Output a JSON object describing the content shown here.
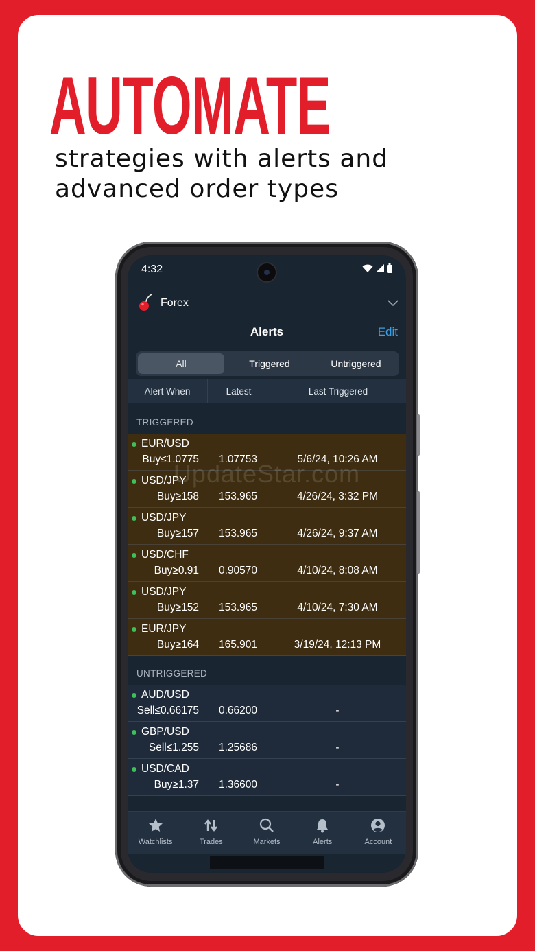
{
  "promo": {
    "headline": "AUTOMATE",
    "subline_1": "strategies with alerts and",
    "subline_2": "advanced order types"
  },
  "colors": {
    "brand_red": "#e31e2b",
    "accent_blue": "#3aa0e8",
    "trigger_row": "#3e2d10",
    "status_green": "#3fbf5a"
  },
  "status_bar": {
    "time": "4:32",
    "icons": [
      "wifi-icon",
      "signal-icon",
      "battery-icon"
    ]
  },
  "account_selector": {
    "label": "Forex",
    "icon": "cherry-icon"
  },
  "header": {
    "title": "Alerts",
    "edit_label": "Edit"
  },
  "segments": [
    {
      "label": "All",
      "selected": true
    },
    {
      "label": "Triggered",
      "selected": false
    },
    {
      "label": "Untriggered",
      "selected": false
    }
  ],
  "columns": [
    "Alert When",
    "Latest",
    "Last Triggered"
  ],
  "watermark": "UpdateStar.com",
  "triggered": {
    "label": "TRIGGERED",
    "rows": [
      {
        "pair": "EUR/USD",
        "condition": "Buy≤1.0775",
        "latest": "1.07753",
        "last_triggered": "5/6/24, 10:26 AM"
      },
      {
        "pair": "USD/JPY",
        "condition": "Buy≥158",
        "latest": "153.965",
        "last_triggered": "4/26/24, 3:32 PM"
      },
      {
        "pair": "USD/JPY",
        "condition": "Buy≥157",
        "latest": "153.965",
        "last_triggered": "4/26/24, 9:37 AM"
      },
      {
        "pair": "USD/CHF",
        "condition": "Buy≥0.91",
        "latest": "0.90570",
        "last_triggered": "4/10/24, 8:08 AM"
      },
      {
        "pair": "USD/JPY",
        "condition": "Buy≥152",
        "latest": "153.965",
        "last_triggered": "4/10/24, 7:30 AM"
      },
      {
        "pair": "EUR/JPY",
        "condition": "Buy≥164",
        "latest": "165.901",
        "last_triggered": "3/19/24, 12:13 PM"
      }
    ]
  },
  "untriggered": {
    "label": "UNTRIGGERED",
    "rows": [
      {
        "pair": "AUD/USD",
        "condition": "Sell≤0.66175",
        "latest": "0.66200",
        "last_triggered": "-"
      },
      {
        "pair": "GBP/USD",
        "condition": "Sell≤1.255",
        "latest": "1.25686",
        "last_triggered": "-"
      },
      {
        "pair": "USD/CAD",
        "condition": "Buy≥1.37",
        "latest": "1.36600",
        "last_triggered": "-"
      }
    ]
  },
  "tabs": [
    {
      "label": "Watchlists",
      "icon": "star-icon"
    },
    {
      "label": "Trades",
      "icon": "trades-arrows-icon"
    },
    {
      "label": "Markets",
      "icon": "search-icon"
    },
    {
      "label": "Alerts",
      "icon": "bell-icon"
    },
    {
      "label": "Account",
      "icon": "account-icon"
    }
  ]
}
